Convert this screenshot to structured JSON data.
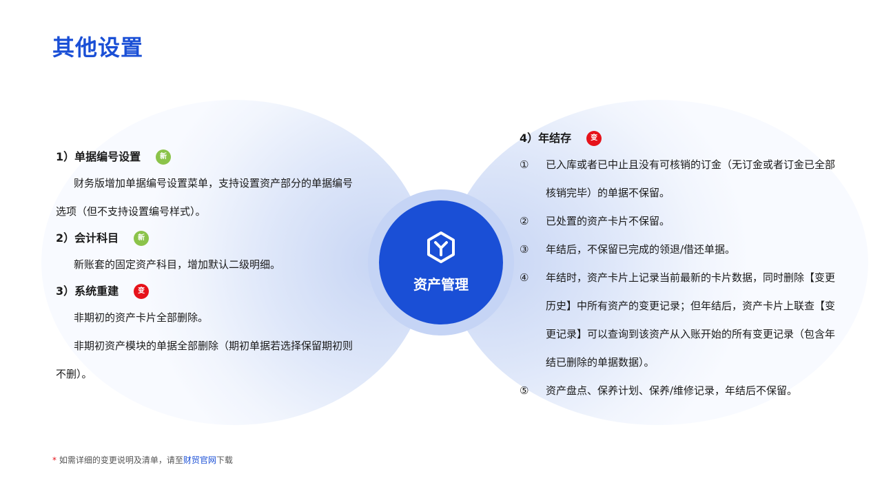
{
  "page": {
    "title": "其他设置"
  },
  "center": {
    "label": "资产管理",
    "icon": "box-y-icon"
  },
  "left": {
    "sections": [
      {
        "heading": "1）单据编号设置",
        "badge": "新",
        "paragraphs": [
          "财务版增加单据编号设置菜单，支持设置资产部分的单据编号选项（但不支持设置编号样式）。"
        ]
      },
      {
        "heading": "2）会计科目",
        "badge": "新",
        "paragraphs": [
          "新账套的固定资产科目，增加默认二级明细。"
        ]
      },
      {
        "heading": "3）系统重建",
        "badge": "变",
        "paragraphs": [
          "非期初的资产卡片全部删除。",
          "非期初资产模块的单据全部删除（期初单据若选择保留期初则不删）。"
        ]
      }
    ]
  },
  "right": {
    "heading": "4）年结存",
    "badge": "变",
    "items": [
      {
        "num": "①",
        "text": "已入库或者已中止且没有可核销的订金（无订金或者订金已全部核销完毕）的单据不保留。"
      },
      {
        "num": "②",
        "text": "已处置的资产卡片不保留。"
      },
      {
        "num": "③",
        "text": "年结后，不保留已完成的领退/借还单据。"
      },
      {
        "num": "④",
        "text": "年结时，资产卡片上记录当前最新的卡片数据，同时删除【变更历史】中所有资产的变更记录；但年结后，资产卡片上联查【变更记录】可以查询到该资产从入账开始的所有变更记录（包含年结已删除的单据数据）。"
      },
      {
        "num": "⑤",
        "text": "资产盘点、保养计划、保养/维修记录，年结后不保留。"
      }
    ]
  },
  "footnote": {
    "star": "*",
    "text_before": " 如需详细的变更说明及清单，请至",
    "link": "财贸官网",
    "text_after": "下载"
  },
  "colors": {
    "accent": "#1a4fd6",
    "new_badge": "#8bc34a",
    "change_badge": "#e6121a"
  }
}
